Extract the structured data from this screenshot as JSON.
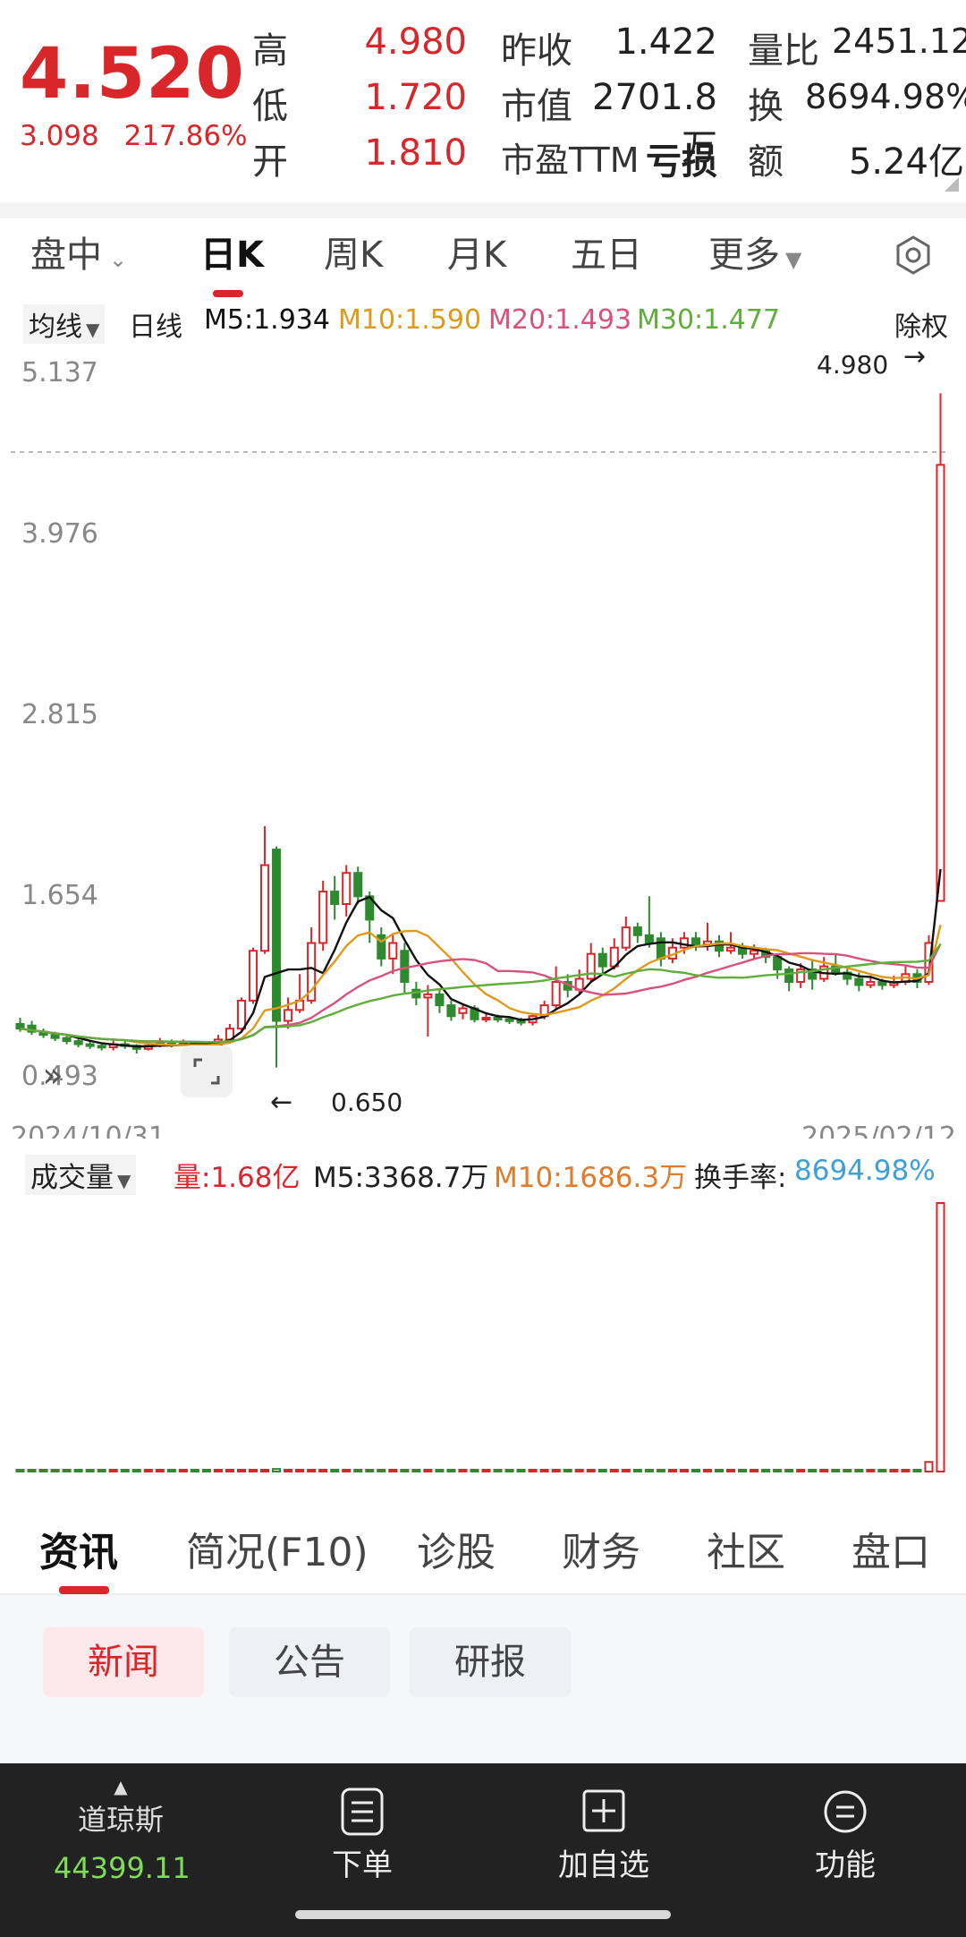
{
  "quote": {
    "price": "4.520",
    "change": "3.098",
    "change_pct": "217.86%",
    "stats": [
      {
        "label": "高",
        "value": "4.980",
        "red": true
      },
      {
        "label": "低",
        "value": "1.720",
        "red": true
      },
      {
        "label": "开",
        "value": "1.810",
        "red": true
      },
      {
        "label": "昨收",
        "value": "1.422",
        "red": false
      },
      {
        "label": "市值",
        "value": "2701.8万",
        "red": false
      },
      {
        "label": "市盈TTM",
        "value": "亏损",
        "red": false
      },
      {
        "label": "量比",
        "value": "2451.12",
        "red": false
      },
      {
        "label": "换",
        "value": "8694.98%",
        "red": false
      },
      {
        "label": "额",
        "value": "5.24亿",
        "red": false
      }
    ]
  },
  "period_tabs": [
    "盘中",
    "日K",
    "周K",
    "月K",
    "五日",
    "更多"
  ],
  "active_period": "日K",
  "ma": {
    "type_label": "均线",
    "line_label": "日线",
    "m5": "M5:1.934",
    "m10": "M10:1.590",
    "m20": "M20:1.493",
    "m30": "M30:1.477",
    "right_label": "除权",
    "colors": {
      "m5": "#111111",
      "m10": "#e09a1b",
      "m20": "#d9527a",
      "m30": "#5fae3c"
    }
  },
  "kchart": {
    "y_ticks": [
      "5.137",
      "3.976",
      "2.815",
      "1.654",
      "0.493"
    ],
    "high_label": "4.980",
    "low_label": "0.650",
    "start_date": "2024/10/31",
    "end_date": "2025/02/12"
  },
  "volume": {
    "label": "成交量",
    "vol": "量:1.68亿",
    "m5": "M5:3368.7万",
    "m10": "M10:1686.3万",
    "turnover_label": "换手率:",
    "turnover": "8694.98%"
  },
  "info_tabs": [
    "资讯",
    "简况(F10)",
    "诊股",
    "财务",
    "社区",
    "盘口"
  ],
  "active_info_tab": "资讯",
  "sub_chips": [
    "新闻",
    "公告",
    "研报"
  ],
  "bottom_bar": {
    "index_name": "道琼斯",
    "index_value": "44399.11",
    "items": [
      "下单",
      "加自选",
      "功能"
    ]
  },
  "chart_data": {
    "type": "candlestick",
    "ylim": [
      0.493,
      5.137
    ],
    "x_start": "2024/10/31",
    "x_end": "2025/02/12",
    "candles": [
      {
        "o": 0.93,
        "c": 0.9,
        "h": 0.97,
        "l": 0.88
      },
      {
        "o": 0.92,
        "c": 0.88,
        "h": 0.95,
        "l": 0.86
      },
      {
        "o": 0.88,
        "c": 0.86,
        "h": 0.9,
        "l": 0.84
      },
      {
        "o": 0.86,
        "c": 0.84,
        "h": 0.88,
        "l": 0.82
      },
      {
        "o": 0.84,
        "c": 0.82,
        "h": 0.86,
        "l": 0.8
      },
      {
        "o": 0.82,
        "c": 0.8,
        "h": 0.84,
        "l": 0.78
      },
      {
        "o": 0.8,
        "c": 0.79,
        "h": 0.82,
        "l": 0.77
      },
      {
        "o": 0.79,
        "c": 0.78,
        "h": 0.81,
        "l": 0.76
      },
      {
        "o": 0.78,
        "c": 0.8,
        "h": 0.83,
        "l": 0.76
      },
      {
        "o": 0.8,
        "c": 0.79,
        "h": 0.82,
        "l": 0.77
      },
      {
        "o": 0.79,
        "c": 0.77,
        "h": 0.8,
        "l": 0.74
      },
      {
        "o": 0.77,
        "c": 0.79,
        "h": 0.82,
        "l": 0.76
      },
      {
        "o": 0.79,
        "c": 0.81,
        "h": 0.84,
        "l": 0.78
      },
      {
        "o": 0.81,
        "c": 0.8,
        "h": 0.83,
        "l": 0.78
      },
      {
        "o": 0.8,
        "c": 0.81,
        "h": 0.83,
        "l": 0.79
      },
      {
        "o": 0.81,
        "c": 0.8,
        "h": 0.82,
        "l": 0.78
      },
      {
        "o": 0.8,
        "c": 0.79,
        "h": 0.82,
        "l": 0.77
      },
      {
        "o": 0.79,
        "c": 0.83,
        "h": 0.86,
        "l": 0.78
      },
      {
        "o": 0.83,
        "c": 0.9,
        "h": 0.93,
        "l": 0.82
      },
      {
        "o": 0.9,
        "c": 1.08,
        "h": 1.1,
        "l": 0.88
      },
      {
        "o": 1.08,
        "c": 1.4,
        "h": 1.42,
        "l": 1.06
      },
      {
        "o": 1.4,
        "c": 1.95,
        "h": 2.2,
        "l": 1.38
      },
      {
        "o": 2.05,
        "c": 0.95,
        "h": 2.07,
        "l": 0.65
      },
      {
        "o": 0.95,
        "c": 1.02,
        "h": 1.1,
        "l": 0.9
      },
      {
        "o": 1.02,
        "c": 1.08,
        "h": 1.25,
        "l": 1.0
      },
      {
        "o": 1.08,
        "c": 1.45,
        "h": 1.55,
        "l": 1.06
      },
      {
        "o": 1.45,
        "c": 1.78,
        "h": 1.85,
        "l": 1.4
      },
      {
        "o": 1.78,
        "c": 1.7,
        "h": 1.88,
        "l": 1.6
      },
      {
        "o": 1.7,
        "c": 1.9,
        "h": 1.95,
        "l": 1.62
      },
      {
        "o": 1.9,
        "c": 1.75,
        "h": 1.94,
        "l": 1.7
      },
      {
        "o": 1.75,
        "c": 1.6,
        "h": 1.78,
        "l": 1.45
      },
      {
        "o": 1.5,
        "c": 1.35,
        "h": 1.55,
        "l": 1.3
      },
      {
        "o": 1.35,
        "c": 1.45,
        "h": 1.5,
        "l": 1.25
      },
      {
        "o": 1.4,
        "c": 1.2,
        "h": 1.45,
        "l": 1.12
      },
      {
        "o": 1.15,
        "c": 1.1,
        "h": 1.2,
        "l": 1.05
      },
      {
        "o": 1.1,
        "c": 1.12,
        "h": 1.18,
        "l": 0.85
      },
      {
        "o": 1.12,
        "c": 1.05,
        "h": 1.15,
        "l": 1.0
      },
      {
        "o": 1.05,
        "c": 0.98,
        "h": 1.08,
        "l": 0.95
      },
      {
        "o": 1.0,
        "c": 1.03,
        "h": 1.06,
        "l": 0.96
      },
      {
        "o": 1.03,
        "c": 0.96,
        "h": 1.05,
        "l": 0.94
      },
      {
        "o": 0.96,
        "c": 0.97,
        "h": 1.0,
        "l": 0.94
      },
      {
        "o": 0.97,
        "c": 0.96,
        "h": 0.99,
        "l": 0.94
      },
      {
        "o": 0.96,
        "c": 0.95,
        "h": 0.98,
        "l": 0.93
      },
      {
        "o": 0.95,
        "c": 0.94,
        "h": 0.97,
        "l": 0.92
      },
      {
        "o": 0.94,
        "c": 0.98,
        "h": 1.0,
        "l": 0.92
      },
      {
        "o": 0.98,
        "c": 1.05,
        "h": 1.08,
        "l": 0.96
      },
      {
        "o": 1.05,
        "c": 1.2,
        "h": 1.3,
        "l": 1.03
      },
      {
        "o": 1.2,
        "c": 1.15,
        "h": 1.25,
        "l": 1.1
      },
      {
        "o": 1.15,
        "c": 1.22,
        "h": 1.28,
        "l": 1.12
      },
      {
        "o": 1.22,
        "c": 1.38,
        "h": 1.45,
        "l": 1.2
      },
      {
        "o": 1.38,
        "c": 1.3,
        "h": 1.42,
        "l": 1.25
      },
      {
        "o": 1.3,
        "c": 1.42,
        "h": 1.48,
        "l": 1.28
      },
      {
        "o": 1.42,
        "c": 1.55,
        "h": 1.62,
        "l": 1.4
      },
      {
        "o": 1.55,
        "c": 1.5,
        "h": 1.58,
        "l": 1.45
      },
      {
        "o": 1.5,
        "c": 1.45,
        "h": 1.75,
        "l": 1.42
      },
      {
        "o": 1.48,
        "c": 1.35,
        "h": 1.52,
        "l": 1.3
      },
      {
        "o": 1.35,
        "c": 1.42,
        "h": 1.48,
        "l": 1.32
      },
      {
        "o": 1.42,
        "c": 1.48,
        "h": 1.52,
        "l": 1.38
      },
      {
        "o": 1.48,
        "c": 1.44,
        "h": 1.52,
        "l": 1.4
      },
      {
        "o": 1.44,
        "c": 1.46,
        "h": 1.58,
        "l": 1.4
      },
      {
        "o": 1.46,
        "c": 1.4,
        "h": 1.5,
        "l": 1.36
      },
      {
        "o": 1.4,
        "c": 1.42,
        "h": 1.52,
        "l": 1.38
      },
      {
        "o": 1.42,
        "c": 1.38,
        "h": 1.45,
        "l": 1.35
      },
      {
        "o": 1.38,
        "c": 1.4,
        "h": 1.44,
        "l": 1.34
      },
      {
        "o": 1.4,
        "c": 1.36,
        "h": 1.42,
        "l": 1.32
      },
      {
        "o": 1.36,
        "c": 1.28,
        "h": 1.38,
        "l": 1.22
      },
      {
        "o": 1.28,
        "c": 1.2,
        "h": 1.3,
        "l": 1.14
      },
      {
        "o": 1.2,
        "c": 1.28,
        "h": 1.32,
        "l": 1.16
      },
      {
        "o": 1.28,
        "c": 1.22,
        "h": 1.34,
        "l": 1.15
      },
      {
        "o": 1.22,
        "c": 1.3,
        "h": 1.36,
        "l": 1.2
      },
      {
        "o": 1.3,
        "c": 1.26,
        "h": 1.38,
        "l": 1.24
      },
      {
        "o": 1.26,
        "c": 1.22,
        "h": 1.3,
        "l": 1.18
      },
      {
        "o": 1.22,
        "c": 1.18,
        "h": 1.26,
        "l": 1.14
      },
      {
        "o": 1.18,
        "c": 1.2,
        "h": 1.24,
        "l": 1.16
      },
      {
        "o": 1.2,
        "c": 1.18,
        "h": 1.22,
        "l": 1.15
      },
      {
        "o": 1.18,
        "c": 1.2,
        "h": 1.24,
        "l": 1.16
      },
      {
        "o": 1.2,
        "c": 1.25,
        "h": 1.3,
        "l": 1.18
      },
      {
        "o": 1.25,
        "c": 1.2,
        "h": 1.28,
        "l": 1.16
      },
      {
        "o": 1.2,
        "c": 1.45,
        "h": 1.5,
        "l": 1.18
      },
      {
        "o": 1.72,
        "c": 4.52,
        "h": 4.98,
        "l": 1.72
      }
    ],
    "volume_max": 1.68
  }
}
